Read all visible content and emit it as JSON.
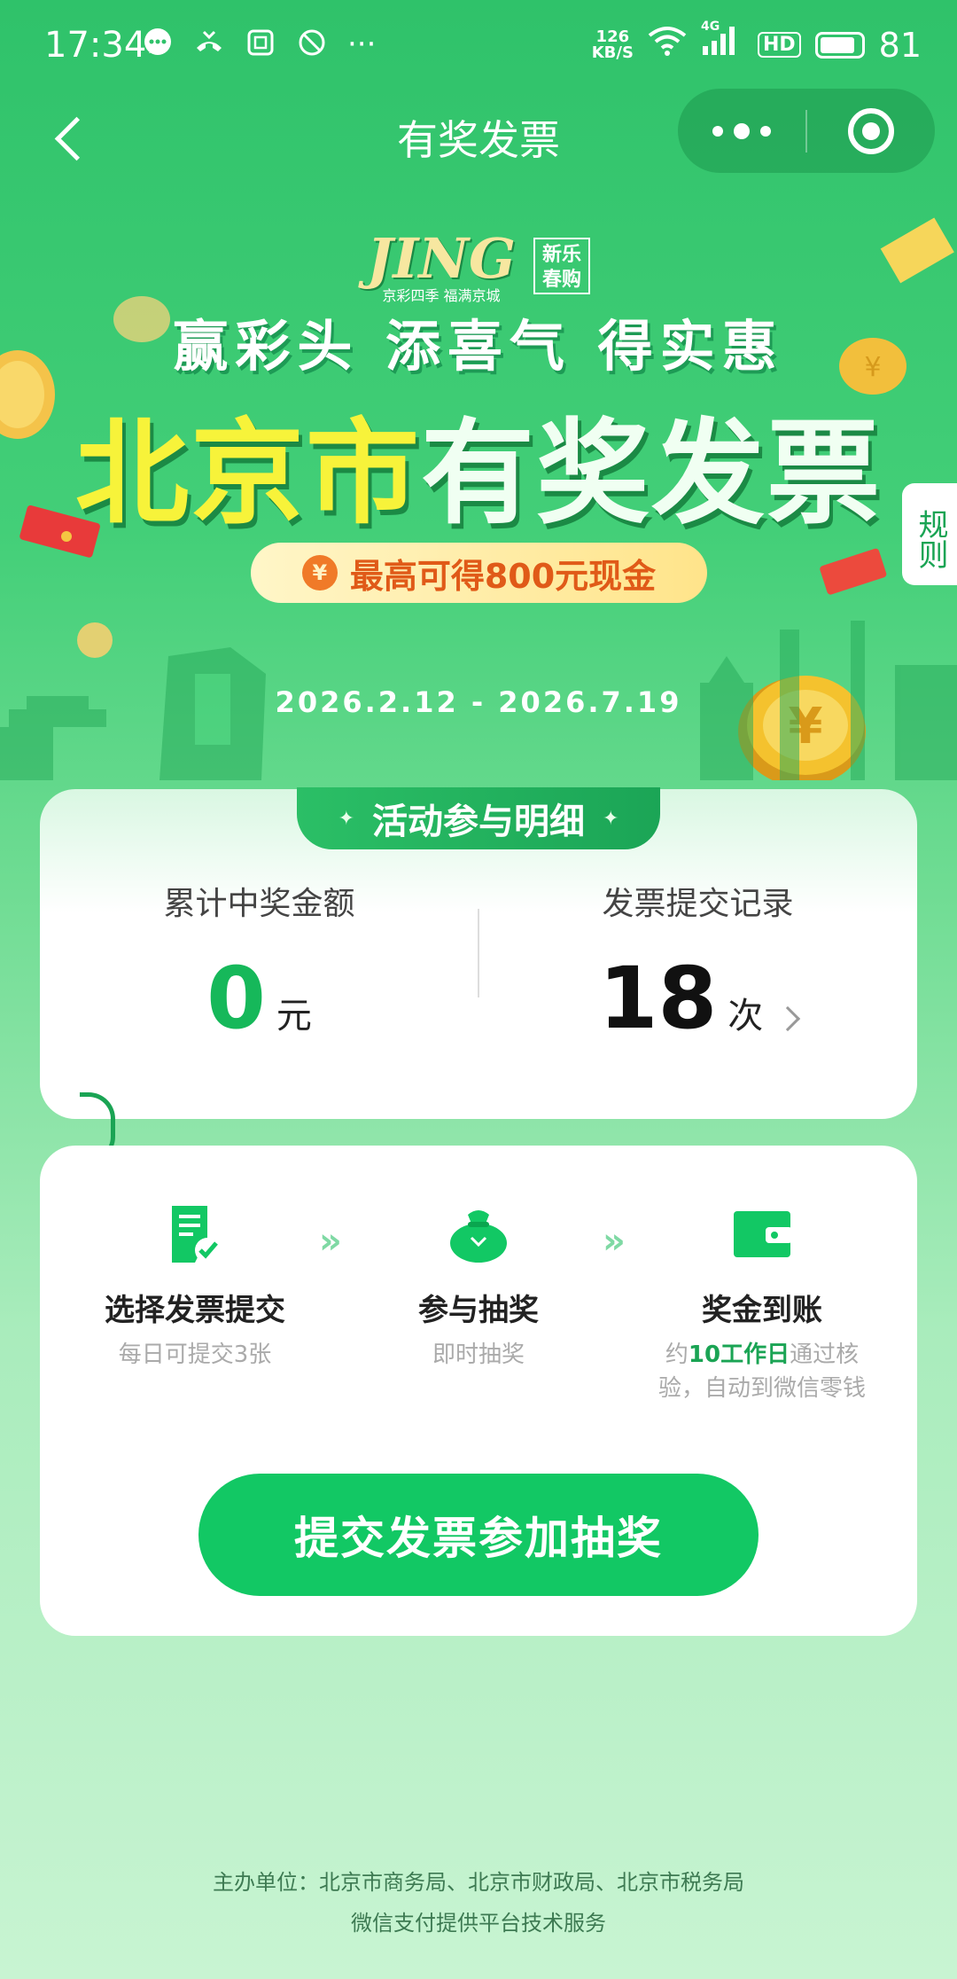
{
  "status_bar": {
    "time": "17:34",
    "net_speed_value": "126",
    "net_speed_unit": "KB/S",
    "network": "4G",
    "hd": "HD",
    "battery": "81",
    "more": "···"
  },
  "nav": {
    "title": "有奖发票"
  },
  "banner": {
    "logo_text": "JING",
    "logo_sub": "京彩四季 福满京城",
    "seal_line1": "新乐",
    "seal_line2": "春购",
    "slogan": "赢彩头 添喜气 得实惠",
    "title_part1": "北京市",
    "title_part2": "有奖发票",
    "prize_text": "最高可得800元现金",
    "coin_symbol": "¥",
    "date_range": "2026.2.12 - 2026.7.19",
    "rules_label": "规则"
  },
  "summary": {
    "tab_title": "活动参与明细",
    "star": "✦",
    "left": {
      "label": "累计中奖金额",
      "value": "0",
      "unit": "元"
    },
    "right": {
      "label": "发票提交记录",
      "value": "18",
      "unit": "次"
    }
  },
  "steps": [
    {
      "title": "选择发票提交",
      "desc": "每日可提交3张"
    },
    {
      "title": "参与抽奖",
      "desc": "即时抽奖"
    },
    {
      "title": "奖金到账",
      "desc_pre": "约",
      "desc_hl": "10工作日",
      "desc_post": "通过核验，自动到微信零钱"
    }
  ],
  "arrow_glyph": "»",
  "cta": {
    "label": "提交发票参加抽奖"
  },
  "footer": {
    "line1": "主办单位：北京市商务局、北京市财政局、北京市税务局",
    "line2": "微信支付提供平台技术服务"
  },
  "colors": {
    "brand_green": "#12c864",
    "accent_yellow": "#f7f33a",
    "prize_orange": "#e05a18"
  }
}
